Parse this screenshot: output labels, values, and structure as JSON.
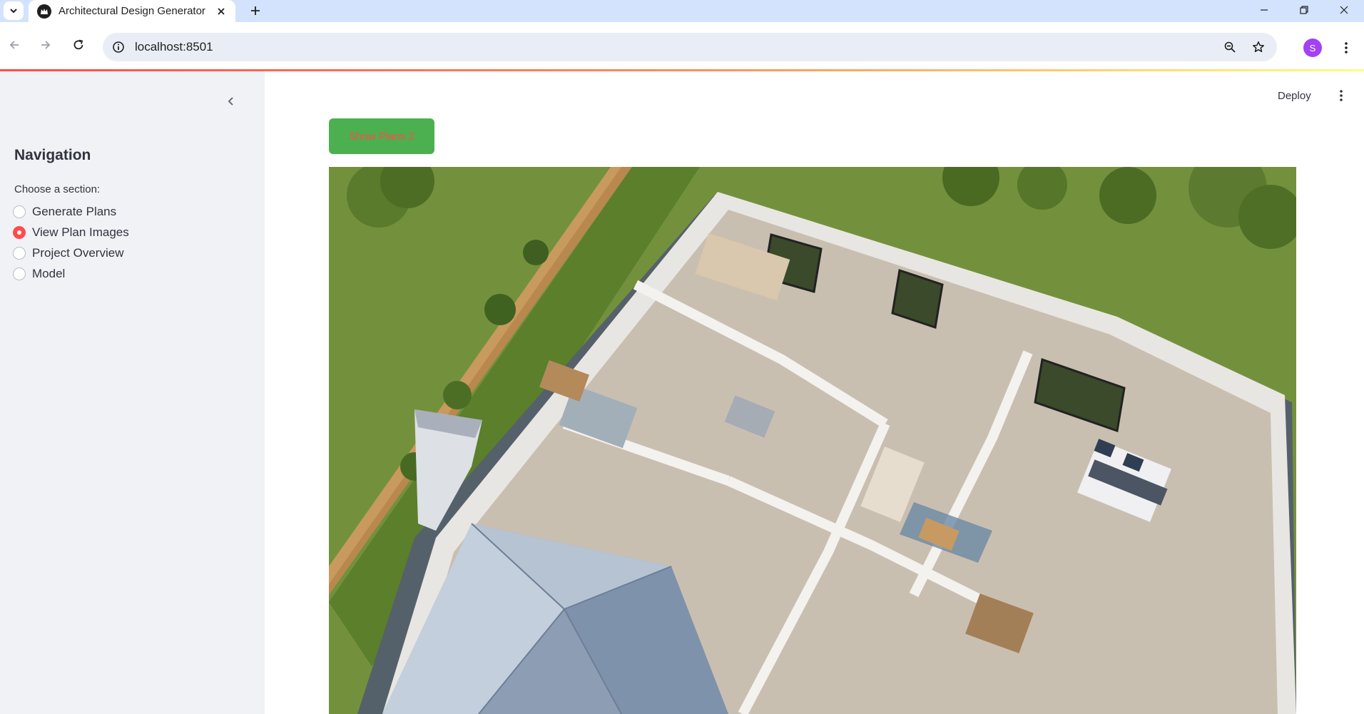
{
  "browser": {
    "tab_title": "Architectural Design Generator",
    "url": "localhost:8501",
    "profile_initial": "S"
  },
  "sidebar": {
    "title": "Navigation",
    "radio_label": "Choose a section:",
    "options": [
      {
        "label": "Generate Plans",
        "selected": false
      },
      {
        "label": "View Plan Images",
        "selected": true
      },
      {
        "label": "Project Overview",
        "selected": false
      },
      {
        "label": "Model",
        "selected": false
      }
    ]
  },
  "main": {
    "deploy_label": "Deploy",
    "show_button_label": "Show Plans 2",
    "image_alt": "3D isometric floor plan of a house"
  },
  "colors": {
    "accent": "#ff4b4b",
    "button_bg": "#4caf50",
    "sidebar_bg": "#f0f2f6"
  }
}
